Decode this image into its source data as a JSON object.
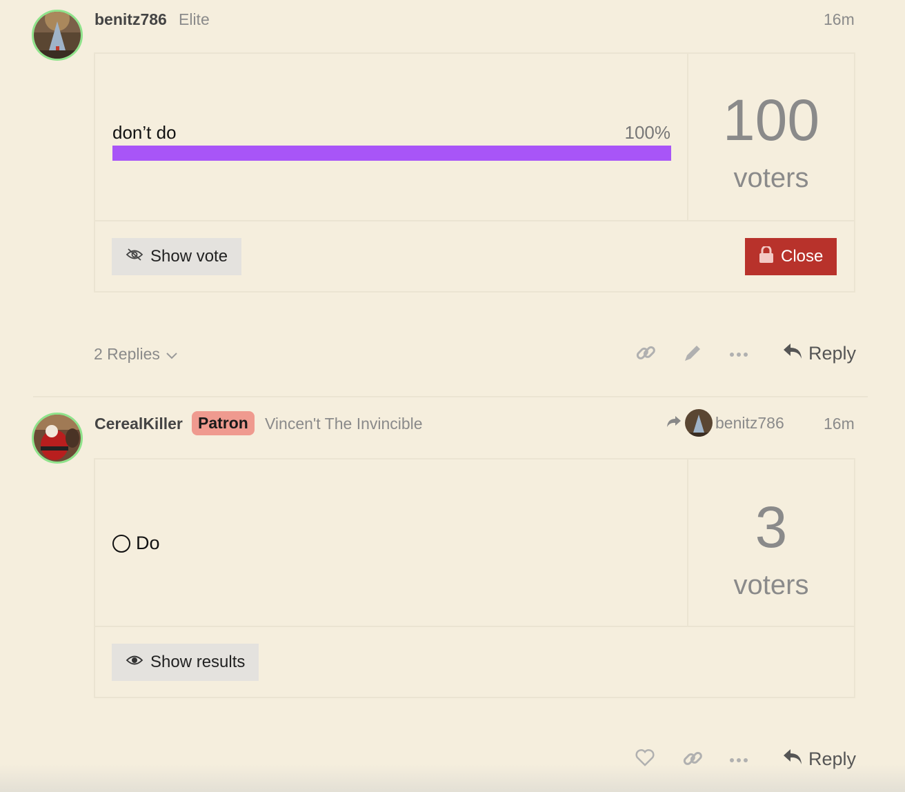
{
  "post1": {
    "username": "benitz786",
    "user_title": "Elite",
    "time": "16m",
    "poll": {
      "option_label": "don’t do",
      "option_percent": "100%",
      "option_fraction": 1.0,
      "voters_count": "100",
      "voters_label": "voters",
      "show_vote_label": "Show vote",
      "close_label": "Close"
    },
    "replies_label": "2 Replies",
    "reply_label": "Reply"
  },
  "post2": {
    "username": "CerealKiller",
    "flair": "Patron",
    "user_title": "Vincen't The Invincible",
    "reply_to_user": "benitz786",
    "time": "16m",
    "poll": {
      "option_label": "Do",
      "voters_count": "3",
      "voters_label": "voters",
      "show_results_label": "Show results"
    },
    "reply_label": "Reply"
  },
  "colors": {
    "background": "#f5eedd",
    "poll_bar": "#a855f7",
    "close_button": "#b8322b",
    "avatar_ring": "#8fe38b",
    "flair_bg": "#ef9a8f"
  }
}
